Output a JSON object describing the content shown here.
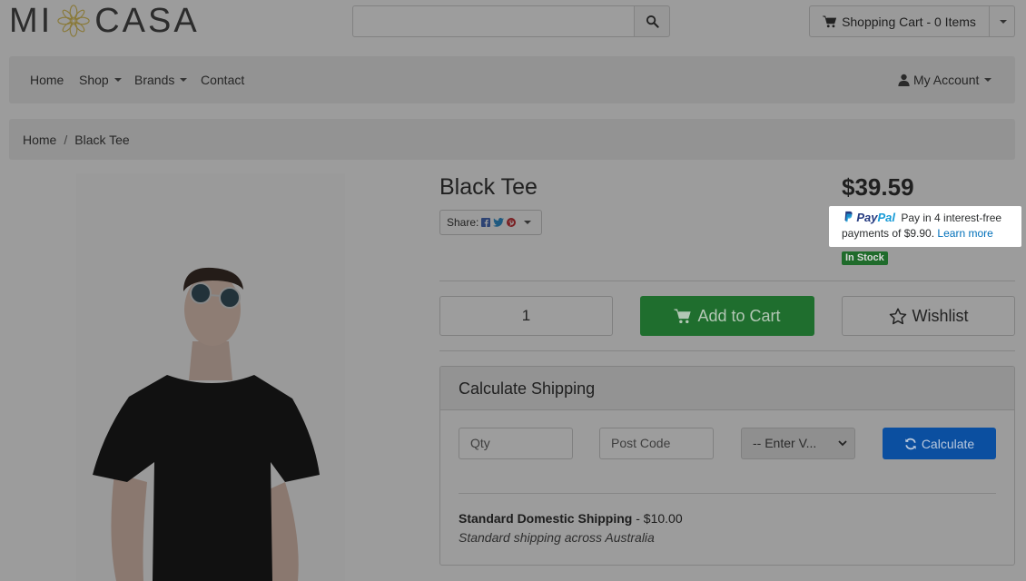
{
  "header": {
    "logo_left": "MI",
    "logo_right": "CASA",
    "search": {
      "placeholder": ""
    },
    "cart_label": "Shopping Cart - 0 Items"
  },
  "nav": {
    "items": [
      {
        "label": "Home"
      },
      {
        "label": "Shop"
      },
      {
        "label": "Brands"
      },
      {
        "label": "Contact"
      }
    ],
    "account_label": "My Account"
  },
  "breadcrumb": {
    "home": "Home",
    "separator": "/",
    "current": "Black Tee"
  },
  "product": {
    "title": "Black Tee",
    "share_label": "Share:",
    "price": "$39.59",
    "stock": "In Stock",
    "quantity": "1",
    "add_to_cart": "Add to Cart",
    "wishlist": "Wishlist"
  },
  "paypal": {
    "logo_pay": "Pay",
    "logo_pal": "Pal",
    "line1": "Pay in 4 interest-free",
    "line2": "payments of $9.90.",
    "link": "Learn more"
  },
  "shipping": {
    "heading": "Calculate Shipping",
    "qty_placeholder": "Qty",
    "postcode_placeholder": "Post Code",
    "select_value": "-- Enter V...",
    "calculate": "Calculate",
    "option_name": "Standard Domestic Shipping",
    "option_price": " - $10.00",
    "option_desc": "Standard shipping across Australia"
  },
  "colors": {
    "add_to_cart": "#1f6e2e",
    "calculate": "#0b4fa0",
    "in_stock": "#1f6b2b",
    "paypal_blue": "#253b80",
    "paypal_light": "#179bd7"
  }
}
